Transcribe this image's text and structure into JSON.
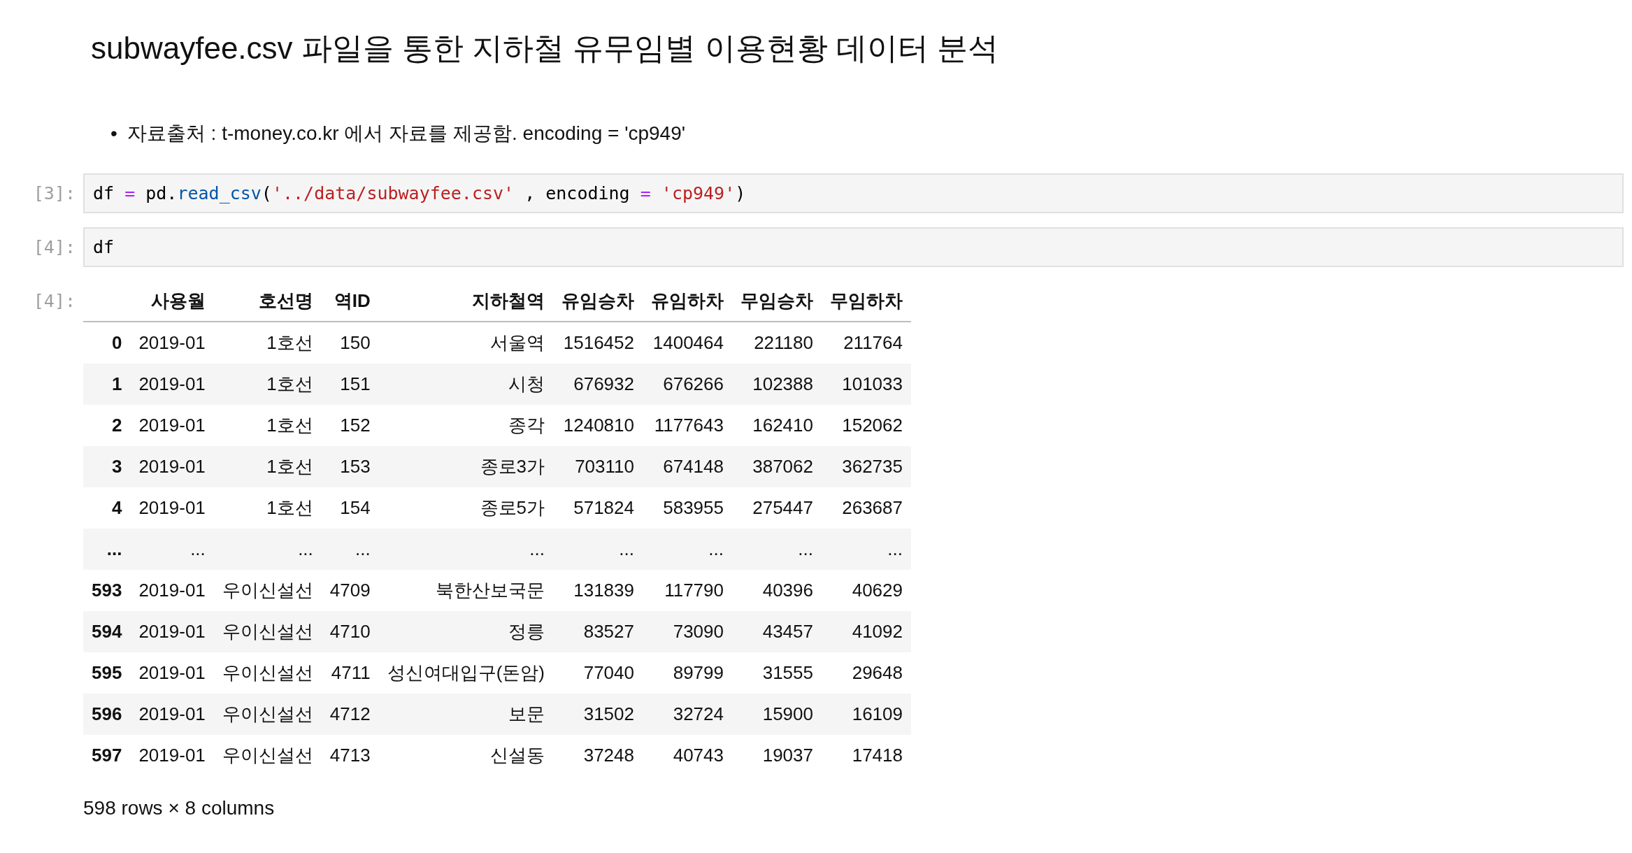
{
  "title": "subwayfee.csv 파일을 통한 지하철 유무임별 이용현황 데이터 분석",
  "bullets": [
    {
      "marker": "•",
      "text": "자료출처 : t-money.co.kr 에서 자료를 제공함. encoding = 'cp949'"
    }
  ],
  "cells": [
    {
      "kind": "code",
      "prompt": "[3]:",
      "tokens": [
        {
          "kind": "name",
          "text": "df "
        },
        {
          "kind": "op",
          "text": "="
        },
        {
          "kind": "name",
          "text": " pd."
        },
        {
          "kind": "func",
          "text": "read_csv"
        },
        {
          "kind": "name",
          "text": "("
        },
        {
          "kind": "string",
          "text": "'../data/subwayfee.csv'"
        },
        {
          "kind": "name",
          "text": " , encoding "
        },
        {
          "kind": "op",
          "text": "= "
        },
        {
          "kind": "string",
          "text": "'cp949'"
        },
        {
          "kind": "name",
          "text": ")"
        }
      ]
    },
    {
      "kind": "code",
      "prompt": "[4]:",
      "tokens": [
        {
          "kind": "name",
          "text": "df"
        }
      ]
    },
    {
      "kind": "table",
      "prompt": "[4]:",
      "columns": [
        "사용월",
        "호선명",
        "역ID",
        "지하철역",
        "유임승차",
        "유임하차",
        "무임승차",
        "무임하차"
      ],
      "rows": [
        {
          "index": "0",
          "cells": [
            "2019-01",
            "1호선",
            "150",
            "서울역",
            "1516452",
            "1400464",
            "221180",
            "211764"
          ]
        },
        {
          "index": "1",
          "cells": [
            "2019-01",
            "1호선",
            "151",
            "시청",
            "676932",
            "676266",
            "102388",
            "101033"
          ]
        },
        {
          "index": "2",
          "cells": [
            "2019-01",
            "1호선",
            "152",
            "종각",
            "1240810",
            "1177643",
            "162410",
            "152062"
          ]
        },
        {
          "index": "3",
          "cells": [
            "2019-01",
            "1호선",
            "153",
            "종로3가",
            "703110",
            "674148",
            "387062",
            "362735"
          ]
        },
        {
          "index": "4",
          "cells": [
            "2019-01",
            "1호선",
            "154",
            "종로5가",
            "571824",
            "583955",
            "275447",
            "263687"
          ]
        },
        {
          "index": "...",
          "cells": [
            "...",
            "...",
            "...",
            "...",
            "...",
            "...",
            "...",
            "..."
          ]
        },
        {
          "index": "593",
          "cells": [
            "2019-01",
            "우이신설선",
            "4709",
            "북한산보국문",
            "131839",
            "117790",
            "40396",
            "40629"
          ]
        },
        {
          "index": "594",
          "cells": [
            "2019-01",
            "우이신설선",
            "4710",
            "정릉",
            "83527",
            "73090",
            "43457",
            "41092"
          ]
        },
        {
          "index": "595",
          "cells": [
            "2019-01",
            "우이신설선",
            "4711",
            "성신여대입구(돈암)",
            "77040",
            "89799",
            "31555",
            "29648"
          ]
        },
        {
          "index": "596",
          "cells": [
            "2019-01",
            "우이신설선",
            "4712",
            "보문",
            "31502",
            "32724",
            "15900",
            "16109"
          ]
        },
        {
          "index": "597",
          "cells": [
            "2019-01",
            "우이신설선",
            "4713",
            "신설동",
            "37248",
            "40743",
            "19037",
            "17418"
          ]
        }
      ],
      "footer": "598 rows × 8 columns"
    }
  ]
}
